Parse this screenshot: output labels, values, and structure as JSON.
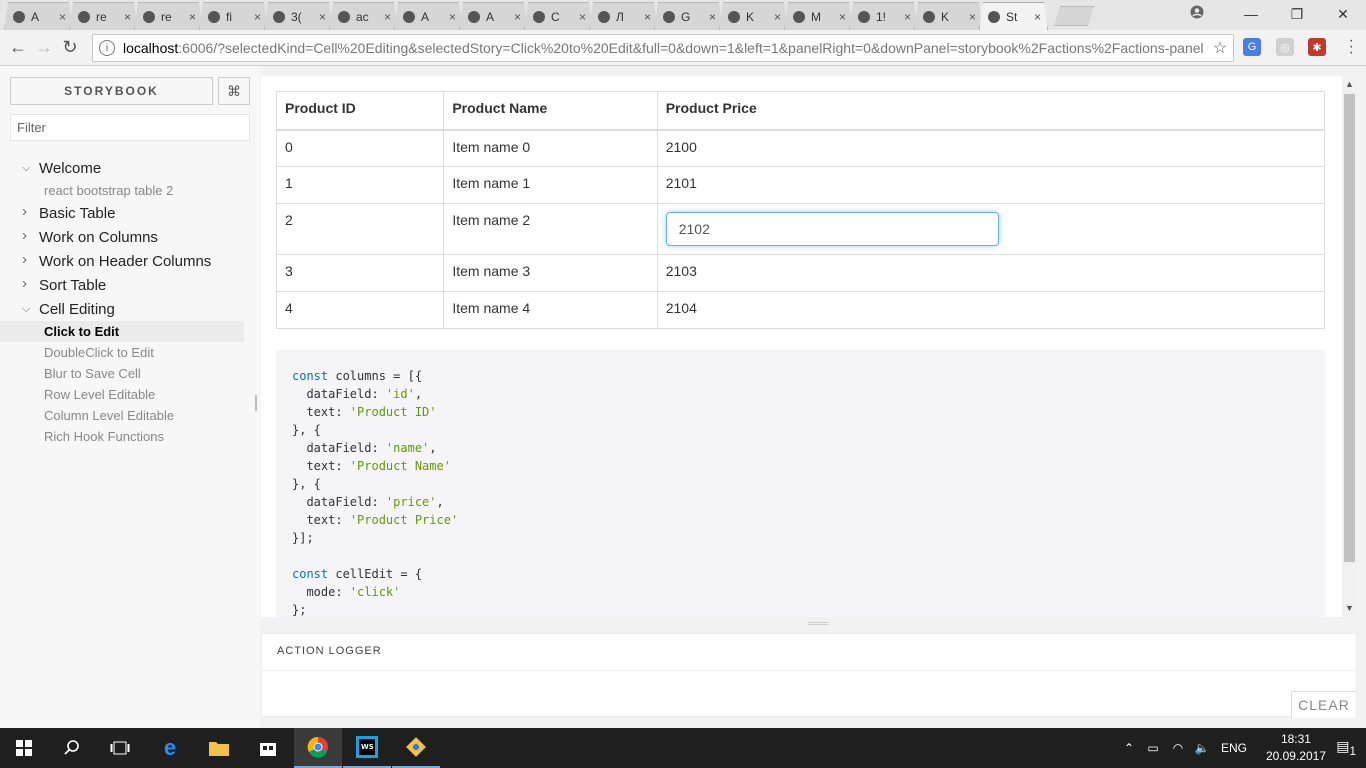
{
  "browser": {
    "tabs": [
      {
        "icon": "github-icon",
        "title": "A"
      },
      {
        "icon": "github-icon",
        "title": "re"
      },
      {
        "icon": "github-icon",
        "title": "re"
      },
      {
        "icon": "github-icon",
        "title": "fi"
      },
      {
        "icon": "doc-icon",
        "title": "3("
      },
      {
        "icon": "google-icon",
        "title": "ac"
      },
      {
        "icon": "h-icon",
        "title": "A"
      },
      {
        "icon": "h-icon",
        "title": "A"
      },
      {
        "icon": "gear-blue-icon",
        "title": "C"
      },
      {
        "icon": "swirl-icon",
        "title": "Л"
      },
      {
        "icon": "yandex-icon",
        "title": "G"
      },
      {
        "icon": "h-icon",
        "title": "K"
      },
      {
        "icon": "circle-icon",
        "title": "M"
      },
      {
        "icon": "card-icon",
        "title": "1!"
      },
      {
        "icon": "kotlin-icon",
        "title": "K"
      },
      {
        "icon": "storybook-icon",
        "title": "St"
      }
    ],
    "close_glyph": "×",
    "url_host": "localhost",
    "url_rest": ":6006/?selectedKind=Cell%20Editing&selectedStory=Click%20to%20Edit&full=0&down=1&left=1&panelRight=0&downPanel=storybook%2Factions%2Factions-panel"
  },
  "sidebar": {
    "title": "STORYBOOK",
    "shortcut_glyph": "⌘",
    "filter_placeholder": "Filter",
    "tree": [
      {
        "label": "Welcome",
        "expanded": true,
        "children": [
          "react bootstrap table 2"
        ]
      },
      {
        "label": "Basic Table",
        "expanded": false,
        "children": []
      },
      {
        "label": "Work on Columns",
        "expanded": false,
        "children": []
      },
      {
        "label": "Work on Header Columns",
        "expanded": false,
        "children": []
      },
      {
        "label": "Sort Table",
        "expanded": false,
        "children": []
      },
      {
        "label": "Cell Editing",
        "expanded": true,
        "children": [
          "Click to Edit",
          "DoubleClick to Edit",
          "Blur to Save Cell",
          "Row Level Editable",
          "Column Level Editable",
          "Rich Hook Functions"
        ]
      }
    ],
    "selected_story": "Click to Edit"
  },
  "table": {
    "headers": [
      "Product ID",
      "Product Name",
      "Product Price"
    ],
    "rows": [
      [
        "0",
        "Item name 0",
        "2100"
      ],
      [
        "1",
        "Item name 1",
        "2101"
      ],
      [
        "2",
        "Item name 2",
        "2102"
      ],
      [
        "3",
        "Item name 3",
        "2103"
      ],
      [
        "4",
        "Item name 4",
        "2104"
      ]
    ],
    "editing_row": 2,
    "editing_value": "2102"
  },
  "code_lines": [
    [
      [
        "kw",
        "const"
      ],
      [
        "t",
        " columns = [{"
      ]
    ],
    [
      [
        "t",
        "  dataField: "
      ],
      [
        "str",
        "'id'"
      ],
      [
        "t",
        ","
      ]
    ],
    [
      [
        "t",
        "  text: "
      ],
      [
        "str",
        "'Product ID'"
      ]
    ],
    [
      [
        "t",
        "}, {"
      ]
    ],
    [
      [
        "t",
        "  dataField: "
      ],
      [
        "str",
        "'name'"
      ],
      [
        "t",
        ","
      ]
    ],
    [
      [
        "t",
        "  text: "
      ],
      [
        "str",
        "'Product Name'"
      ]
    ],
    [
      [
        "t",
        "}, {"
      ]
    ],
    [
      [
        "t",
        "  dataField: "
      ],
      [
        "str",
        "'price'"
      ],
      [
        "t",
        ","
      ]
    ],
    [
      [
        "t",
        "  text: "
      ],
      [
        "str",
        "'Product Price'"
      ]
    ],
    [
      [
        "t",
        "}];"
      ]
    ],
    [
      [
        "t",
        ""
      ]
    ],
    [
      [
        "kw",
        "const"
      ],
      [
        "t",
        " cellEdit = {"
      ]
    ],
    [
      [
        "t",
        "  mode: "
      ],
      [
        "str",
        "'click'"
      ]
    ],
    [
      [
        "t",
        "};"
      ]
    ]
  ],
  "action_logger": {
    "title": "ACTION LOGGER",
    "clear_label": "CLEAR"
  },
  "taskbar": {
    "language": "ENG",
    "time": "18:31",
    "date": "20.09.2017",
    "notifications": "1"
  }
}
